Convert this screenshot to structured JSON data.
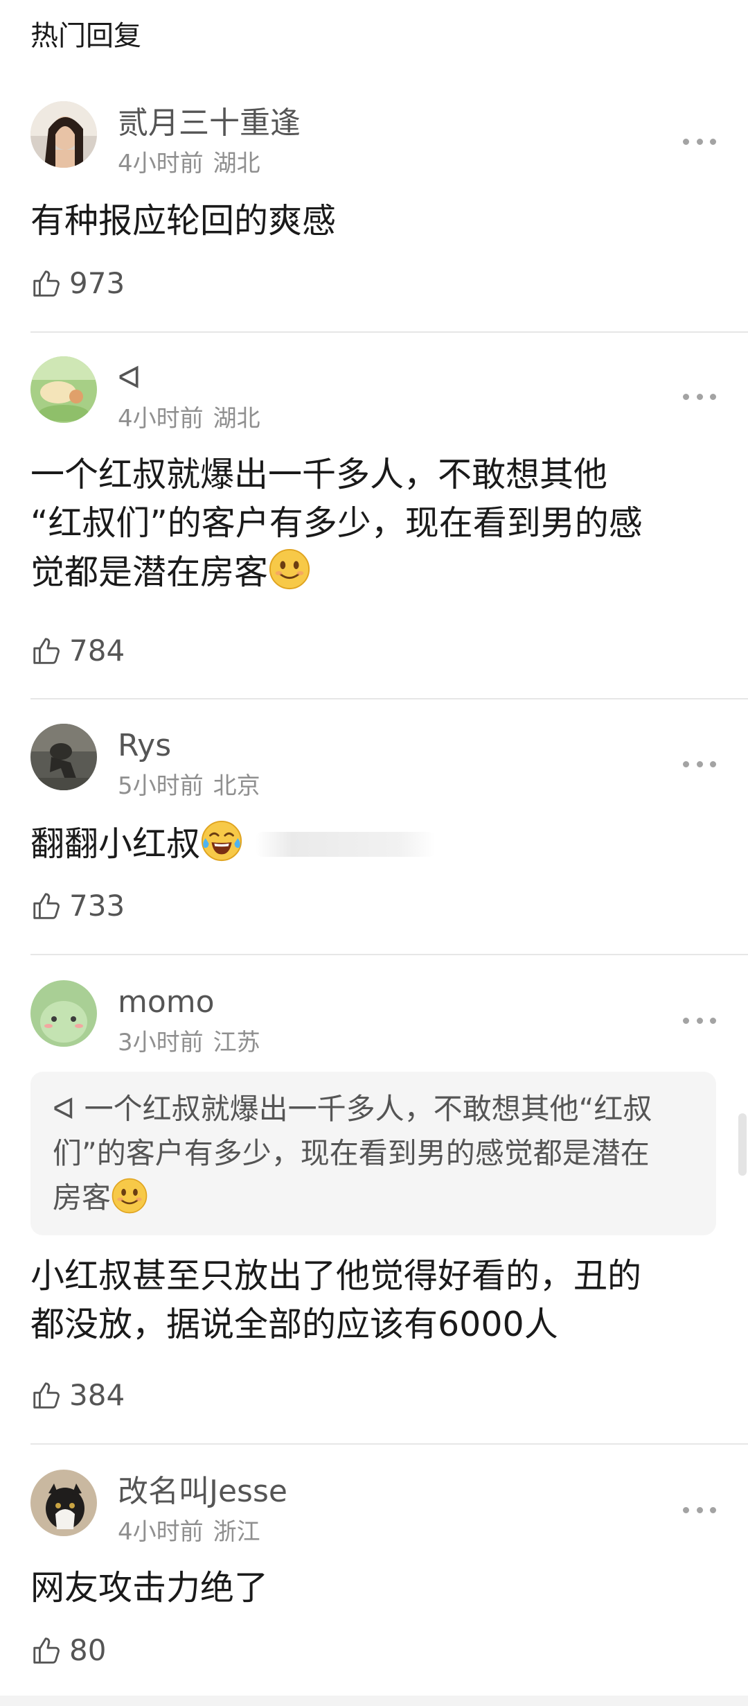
{
  "section_title": "热门回复",
  "comments": [
    {
      "username": "贰月三十重逢",
      "time": "4小时前",
      "location": "湖北",
      "text": "有种报应轮回的爽感",
      "likes": "973"
    },
    {
      "username": "ᐊ",
      "time": "4小时前",
      "location": "湖北",
      "text_line1": "一个红叔就爆出一千多人，不敢想其他",
      "text_line2": "“红叔们”的客户有多少，现在看到男的感",
      "text_line3": "觉都是潜在房客",
      "likes": "784"
    },
    {
      "username": "Rys",
      "time": "5小时前",
      "location": "北京",
      "text": "翻翻小红叔",
      "likes": "733"
    },
    {
      "username": "momo",
      "time": "3小时前",
      "location": "江苏",
      "quote_line1": "ᐊ 一个红叔就爆出一千多人，不敢想其他“红叔",
      "quote_line2": "们”的客户有多少，现在看到男的感觉都是潜在",
      "quote_line3": "房客",
      "text_line1": "小红叔甚至只放出了他觉得好看的，丑的",
      "text_line2": "都没放，据说全部的应该有6000人",
      "likes": "384"
    },
    {
      "username": "改名叫Jesse",
      "time": "4小时前",
      "location": "浙江",
      "text": "网友攻击力绝了",
      "likes": "80"
    }
  ],
  "icons": {
    "like": "thumbs-up-icon",
    "more": "more-dots-icon",
    "emoji_smile": "slight-smile-emoji",
    "emoji_laugh": "tears-of-joy-emoji"
  }
}
